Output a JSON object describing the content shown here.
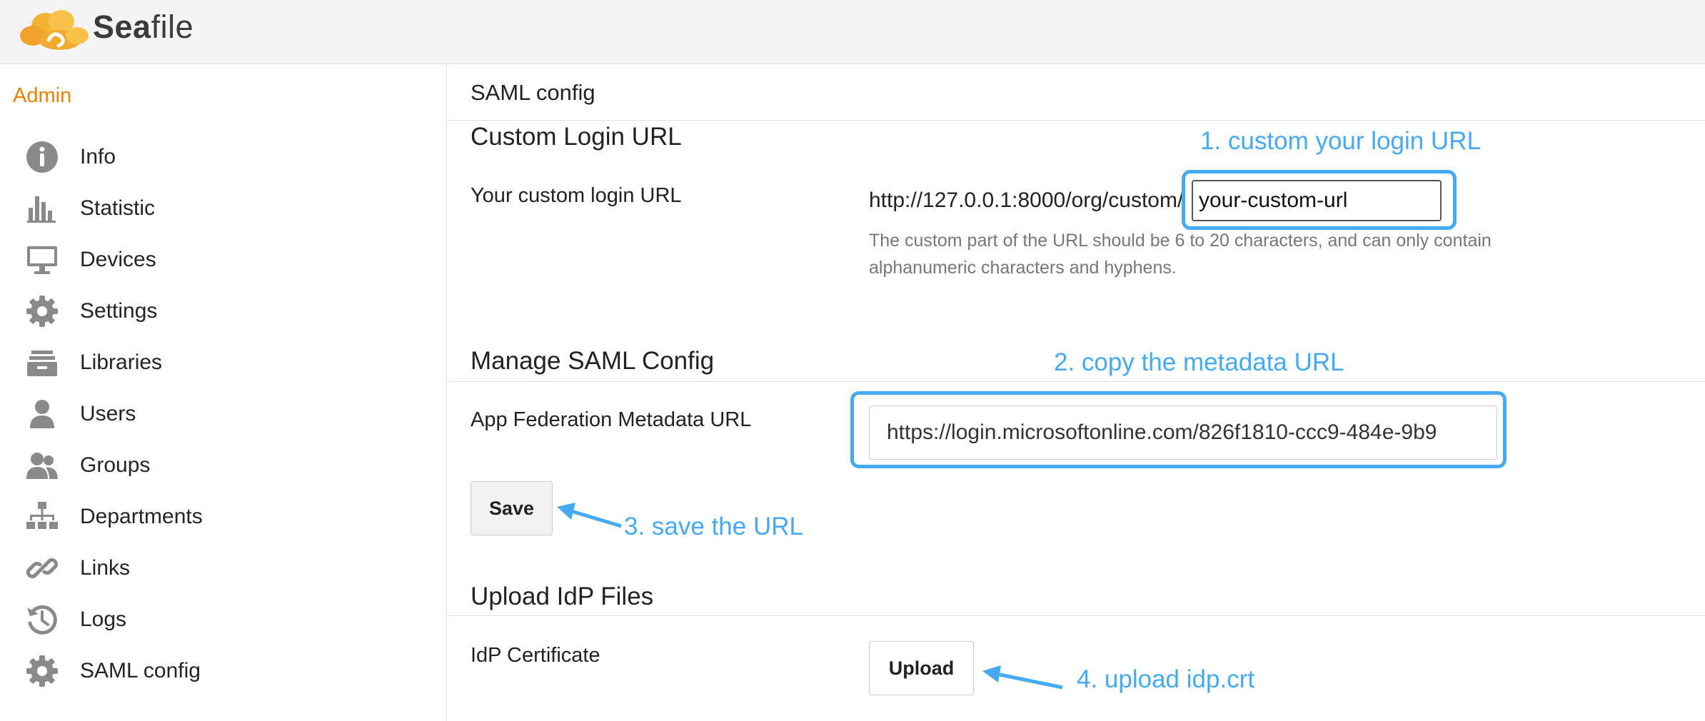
{
  "brand": {
    "name_bold": "Sea",
    "name_rest": "file"
  },
  "sidebar": {
    "title": "Admin",
    "items": [
      {
        "label": "Info",
        "icon": "info-icon"
      },
      {
        "label": "Statistic",
        "icon": "bar-chart-icon"
      },
      {
        "label": "Devices",
        "icon": "monitor-icon"
      },
      {
        "label": "Settings",
        "icon": "gear-icon"
      },
      {
        "label": "Libraries",
        "icon": "library-stack-icon"
      },
      {
        "label": "Users",
        "icon": "user-icon"
      },
      {
        "label": "Groups",
        "icon": "group-icon"
      },
      {
        "label": "Departments",
        "icon": "org-chart-icon"
      },
      {
        "label": "Links",
        "icon": "link-icon"
      },
      {
        "label": "Logs",
        "icon": "history-icon"
      },
      {
        "label": "SAML config",
        "icon": "gear-icon"
      }
    ]
  },
  "main": {
    "page_title": "SAML config",
    "custom_login": {
      "section_title": "Custom Login URL",
      "field_label": "Your custom login URL",
      "url_prefix": "http://127.0.0.1:8000/org/custom/",
      "input_value": "your-custom-url",
      "help_text": "The custom part of the URL should be 6 to 20 characters, and can only contain alphanumeric characters and hyphens."
    },
    "manage_saml": {
      "section_title": "Manage SAML Config",
      "field_label": "App Federation Metadata URL",
      "input_value": "https://login.microsoftonline.com/826f1810-ccc9-484e-9b9",
      "save_label": "Save"
    },
    "upload_idp": {
      "section_title": "Upload IdP Files",
      "field_label": "IdP Certificate",
      "upload_label": "Upload"
    }
  },
  "annotations": {
    "step1": "1. custom your login URL",
    "step2": "2. copy the metadata URL",
    "step3": "3. save the URL",
    "step4": "4. upload idp.crt",
    "color": "#45aaf2"
  },
  "colors": {
    "accent": "#ec8000",
    "icon_gray": "#8a8a8a",
    "annotation": "#45aaf2"
  }
}
